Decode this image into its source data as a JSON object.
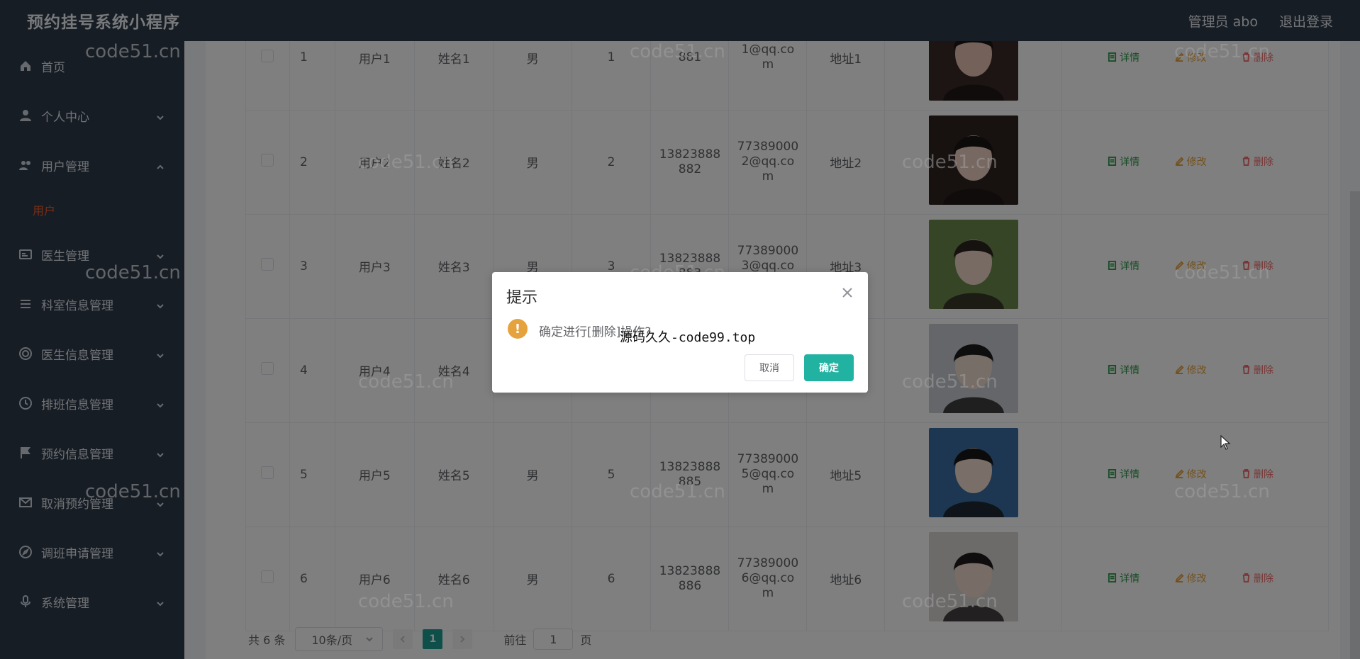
{
  "header": {
    "title": "预约挂号系统小程序",
    "user_label": "管理员 abo",
    "logout_label": "退出登录"
  },
  "sidebar": {
    "items": [
      {
        "label": "首页",
        "icon": "home-icon"
      },
      {
        "label": "个人中心",
        "icon": "user-icon"
      },
      {
        "label": "用户管理",
        "icon": "users-icon",
        "expanded": true
      },
      {
        "label": "医生管理",
        "icon": "id-card-icon"
      },
      {
        "label": "科室信息管理",
        "icon": "list-icon"
      },
      {
        "label": "医生信息管理",
        "icon": "target-icon"
      },
      {
        "label": "排班信息管理",
        "icon": "clock-icon"
      },
      {
        "label": "预约信息管理",
        "icon": "flag-icon"
      },
      {
        "label": "取消预约管理",
        "icon": "mail-icon"
      },
      {
        "label": "调班申请管理",
        "icon": "compass-icon"
      },
      {
        "label": "系统管理",
        "icon": "mic-icon"
      }
    ],
    "subitem_active": "用户"
  },
  "table": {
    "rows": [
      {
        "index": "1",
        "user": "用户1",
        "name": "姓名1",
        "sex": "男",
        "age": "1",
        "phone": "881",
        "email": "1@qq.co m",
        "address": "地址1"
      },
      {
        "index": "2",
        "user": "用户2",
        "name": "姓名2",
        "sex": "男",
        "age": "2",
        "phone": "13823888 882",
        "email": "77389000 2@qq.co m",
        "address": "地址2"
      },
      {
        "index": "3",
        "user": "用户3",
        "name": "姓名3",
        "sex": "男",
        "age": "3",
        "phone": "13823888 883",
        "email": "77389000 3@qq.co m",
        "address": "地址3"
      },
      {
        "index": "4",
        "user": "用户4",
        "name": "姓名4",
        "sex": "",
        "age": "",
        "phone": "",
        "email": "",
        "address": ""
      },
      {
        "index": "5",
        "user": "用户5",
        "name": "姓名5",
        "sex": "男",
        "age": "5",
        "phone": "13823888 885",
        "email": "77389000 5@qq.co m",
        "address": "地址5"
      },
      {
        "index": "6",
        "user": "用户6",
        "name": "姓名6",
        "sex": "男",
        "age": "6",
        "phone": "13823888 886",
        "email": "77389000 6@qq.co m",
        "address": "地址6"
      }
    ],
    "actions": {
      "detail": "详情",
      "edit": "修改",
      "delete": "删除"
    }
  },
  "pagination": {
    "total": "共 6 条",
    "page_size": "10条/页",
    "current_page": "1",
    "goto_label": "前往",
    "goto_value": "1",
    "page_unit": "页"
  },
  "dialog": {
    "title": "提示",
    "message": "确定进行[删除]操作?",
    "overlay_text": "源码久久-code99.top",
    "cancel": "取消",
    "confirm": "确定"
  },
  "watermark": "code51.cn",
  "colors": {
    "header_bg": "#2f3b4a",
    "accent": "#22b2a1",
    "warn": "#e6a23c",
    "active_menu": "#f05a28"
  }
}
